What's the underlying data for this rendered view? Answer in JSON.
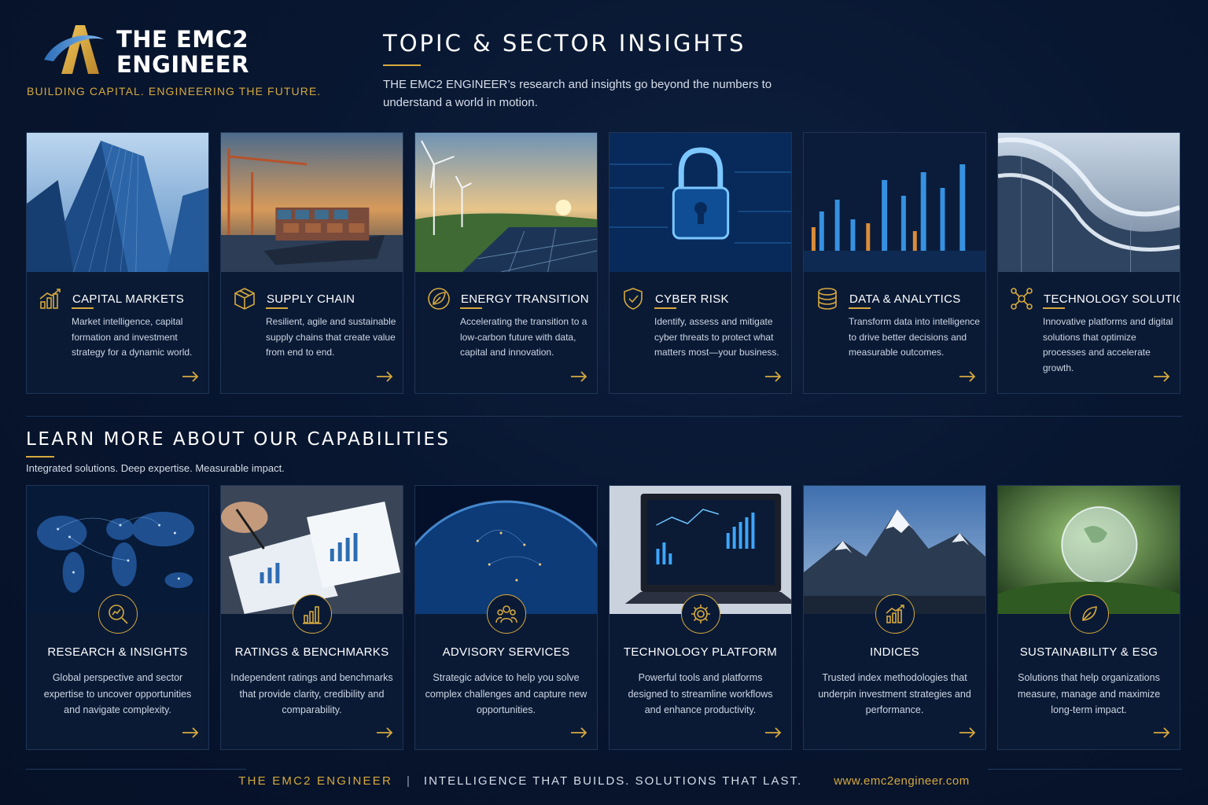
{
  "brand": {
    "name_line1": "THE EMC2",
    "name_line2": "ENGINEER",
    "tagline": "BUILDING CAPITAL. ENGINEERING THE FUTURE."
  },
  "intro": {
    "title": "TOPIC & SECTOR INSIGHTS",
    "description": "THE EMC2 ENGINEER’s research and insights go beyond the numbers to understand a world in motion."
  },
  "topics": [
    {
      "title": "CAPITAL MARKETS",
      "description": "Market intelligence, capital formation and investment strategy for a dynamic world.",
      "icon": "bar-chart-icon"
    },
    {
      "title": "SUPPLY CHAIN",
      "description": "Resilient, agile and sustainable supply chains that create value from end to end.",
      "icon": "box-icon"
    },
    {
      "title": "ENERGY TRANSITION",
      "description": "Accelerating the transition to a low-carbon future with data, capital and innovation.",
      "icon": "leaf-icon"
    },
    {
      "title": "CYBER RISK",
      "description": "Identify, assess and mitigate cyber threats to protect what matters most—your business.",
      "icon": "shield-icon"
    },
    {
      "title": "DATA & ANALYTICS",
      "description": "Transform data into intelligence to drive better decisions and measurable outcomes.",
      "icon": "database-icon"
    },
    {
      "title": "TECHNOLOGY SOLUTIONS",
      "description": "Innovative platforms and digital solutions that optimize processes and accelerate growth.",
      "icon": "network-icon"
    }
  ],
  "capabilities_section": {
    "title": "LEARN MORE ABOUT OUR CAPABILITIES",
    "subtitle": "Integrated solutions. Deep expertise. Measurable impact."
  },
  "capabilities": [
    {
      "title": "RESEARCH & INSIGHTS",
      "description": "Global perspective and sector expertise to uncover opportunities and navigate complexity.",
      "icon": "magnifier-chart-icon"
    },
    {
      "title": "RATINGS & BENCHMARKS",
      "description": "Independent ratings and benchmarks that provide clarity, credibility and comparability.",
      "icon": "bar-chart-icon"
    },
    {
      "title": "ADVISORY SERVICES",
      "description": "Strategic advice to help you solve complex challenges and capture new opportunities.",
      "icon": "people-group-icon"
    },
    {
      "title": "TECHNOLOGY PLATFORM",
      "description": "Powerful tools and platforms designed to streamline workflows and enhance productivity.",
      "icon": "gear-icon"
    },
    {
      "title": "INDICES",
      "description": "Trusted index methodologies that underpin investment strategies and performance.",
      "icon": "trend-chart-icon"
    },
    {
      "title": "SUSTAINABILITY & ESG",
      "description": "Solutions that help organizations measure, manage and maximize long-term impact.",
      "icon": "leaf-icon"
    }
  ],
  "footer": {
    "brand": "THE EMC2 ENGINEER",
    "separator": "|",
    "slogan": "INTELLIGENCE THAT BUILDS. SOLUTIONS THAT LAST.",
    "url": "www.emc2engineer.com"
  },
  "colors": {
    "accent": "#d6a93e",
    "background": "#081630",
    "card": "#0a1a35",
    "border": "#1f3556"
  }
}
